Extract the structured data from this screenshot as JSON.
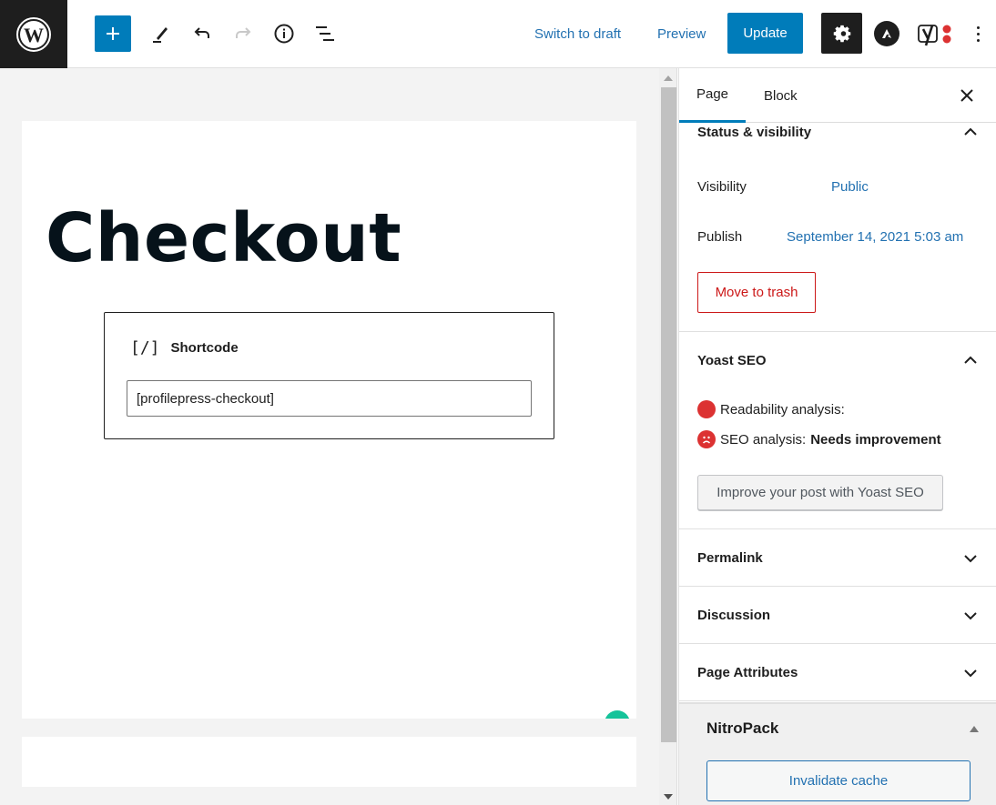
{
  "header": {
    "logo": "wordpress-logo",
    "toolbar_icons": [
      "plus-icon",
      "pencil-icon",
      "undo-icon",
      "redo-icon",
      "info-icon",
      "list-view-icon"
    ],
    "switch_to_draft": "Switch to draft",
    "preview": "Preview",
    "update": "Update",
    "right_icons": [
      "gear-icon",
      "astra-icon",
      "yoast-icon",
      "more-vertical-icon"
    ],
    "colors": {
      "primary": "#007cba",
      "dark": "#1e1e1e",
      "link": "#2271b1"
    }
  },
  "editor": {
    "page_title": "Checkout",
    "shortcode_block": {
      "label": "Shortcode",
      "icon": "[/]",
      "value": "[profilepress-checkout]"
    }
  },
  "sidebar": {
    "tabs": [
      {
        "label": "Page",
        "active": true
      },
      {
        "label": "Block",
        "active": false
      }
    ],
    "status_visibility": {
      "title": "Status & visibility",
      "expanded": true,
      "visibility_label": "Visibility",
      "visibility_value": "Public",
      "publish_label": "Publish",
      "publish_value": "September 14, 2021 5:03 am",
      "trash_button": "Move to trash"
    },
    "yoast": {
      "title": "Yoast SEO",
      "expanded": true,
      "readability_label": "Readability analysis:",
      "seo_label": "SEO analysis:",
      "seo_value": "Needs improvement",
      "improve_button": "Improve your post with Yoast SEO",
      "status_color": "#dc3232"
    },
    "collapsed_panels": [
      {
        "title": "Permalink"
      },
      {
        "title": "Discussion"
      },
      {
        "title": "Page Attributes"
      }
    ],
    "nitropack": {
      "title": "NitroPack",
      "button": "Invalidate cache"
    }
  }
}
